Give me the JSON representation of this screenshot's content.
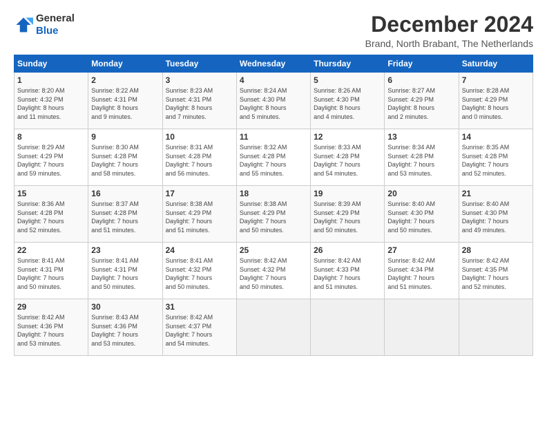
{
  "logo": {
    "line1": "General",
    "line2": "Blue"
  },
  "title": "December 2024",
  "location": "Brand, North Brabant, The Netherlands",
  "days_header": [
    "Sunday",
    "Monday",
    "Tuesday",
    "Wednesday",
    "Thursday",
    "Friday",
    "Saturday"
  ],
  "weeks": [
    [
      {
        "day": 1,
        "lines": [
          "Sunrise: 8:20 AM",
          "Sunset: 4:32 PM",
          "Daylight: 8 hours",
          "and 11 minutes."
        ]
      },
      {
        "day": 2,
        "lines": [
          "Sunrise: 8:22 AM",
          "Sunset: 4:31 PM",
          "Daylight: 8 hours",
          "and 9 minutes."
        ]
      },
      {
        "day": 3,
        "lines": [
          "Sunrise: 8:23 AM",
          "Sunset: 4:31 PM",
          "Daylight: 8 hours",
          "and 7 minutes."
        ]
      },
      {
        "day": 4,
        "lines": [
          "Sunrise: 8:24 AM",
          "Sunset: 4:30 PM",
          "Daylight: 8 hours",
          "and 5 minutes."
        ]
      },
      {
        "day": 5,
        "lines": [
          "Sunrise: 8:26 AM",
          "Sunset: 4:30 PM",
          "Daylight: 8 hours",
          "and 4 minutes."
        ]
      },
      {
        "day": 6,
        "lines": [
          "Sunrise: 8:27 AM",
          "Sunset: 4:29 PM",
          "Daylight: 8 hours",
          "and 2 minutes."
        ]
      },
      {
        "day": 7,
        "lines": [
          "Sunrise: 8:28 AM",
          "Sunset: 4:29 PM",
          "Daylight: 8 hours",
          "and 0 minutes."
        ]
      }
    ],
    [
      {
        "day": 8,
        "lines": [
          "Sunrise: 8:29 AM",
          "Sunset: 4:29 PM",
          "Daylight: 7 hours",
          "and 59 minutes."
        ]
      },
      {
        "day": 9,
        "lines": [
          "Sunrise: 8:30 AM",
          "Sunset: 4:28 PM",
          "Daylight: 7 hours",
          "and 58 minutes."
        ]
      },
      {
        "day": 10,
        "lines": [
          "Sunrise: 8:31 AM",
          "Sunset: 4:28 PM",
          "Daylight: 7 hours",
          "and 56 minutes."
        ]
      },
      {
        "day": 11,
        "lines": [
          "Sunrise: 8:32 AM",
          "Sunset: 4:28 PM",
          "Daylight: 7 hours",
          "and 55 minutes."
        ]
      },
      {
        "day": 12,
        "lines": [
          "Sunrise: 8:33 AM",
          "Sunset: 4:28 PM",
          "Daylight: 7 hours",
          "and 54 minutes."
        ]
      },
      {
        "day": 13,
        "lines": [
          "Sunrise: 8:34 AM",
          "Sunset: 4:28 PM",
          "Daylight: 7 hours",
          "and 53 minutes."
        ]
      },
      {
        "day": 14,
        "lines": [
          "Sunrise: 8:35 AM",
          "Sunset: 4:28 PM",
          "Daylight: 7 hours",
          "and 52 minutes."
        ]
      }
    ],
    [
      {
        "day": 15,
        "lines": [
          "Sunrise: 8:36 AM",
          "Sunset: 4:28 PM",
          "Daylight: 7 hours",
          "and 52 minutes."
        ]
      },
      {
        "day": 16,
        "lines": [
          "Sunrise: 8:37 AM",
          "Sunset: 4:28 PM",
          "Daylight: 7 hours",
          "and 51 minutes."
        ]
      },
      {
        "day": 17,
        "lines": [
          "Sunrise: 8:38 AM",
          "Sunset: 4:29 PM",
          "Daylight: 7 hours",
          "and 51 minutes."
        ]
      },
      {
        "day": 18,
        "lines": [
          "Sunrise: 8:38 AM",
          "Sunset: 4:29 PM",
          "Daylight: 7 hours",
          "and 50 minutes."
        ]
      },
      {
        "day": 19,
        "lines": [
          "Sunrise: 8:39 AM",
          "Sunset: 4:29 PM",
          "Daylight: 7 hours",
          "and 50 minutes."
        ]
      },
      {
        "day": 20,
        "lines": [
          "Sunrise: 8:40 AM",
          "Sunset: 4:30 PM",
          "Daylight: 7 hours",
          "and 50 minutes."
        ]
      },
      {
        "day": 21,
        "lines": [
          "Sunrise: 8:40 AM",
          "Sunset: 4:30 PM",
          "Daylight: 7 hours",
          "and 49 minutes."
        ]
      }
    ],
    [
      {
        "day": 22,
        "lines": [
          "Sunrise: 8:41 AM",
          "Sunset: 4:31 PM",
          "Daylight: 7 hours",
          "and 50 minutes."
        ]
      },
      {
        "day": 23,
        "lines": [
          "Sunrise: 8:41 AM",
          "Sunset: 4:31 PM",
          "Daylight: 7 hours",
          "and 50 minutes."
        ]
      },
      {
        "day": 24,
        "lines": [
          "Sunrise: 8:41 AM",
          "Sunset: 4:32 PM",
          "Daylight: 7 hours",
          "and 50 minutes."
        ]
      },
      {
        "day": 25,
        "lines": [
          "Sunrise: 8:42 AM",
          "Sunset: 4:32 PM",
          "Daylight: 7 hours",
          "and 50 minutes."
        ]
      },
      {
        "day": 26,
        "lines": [
          "Sunrise: 8:42 AM",
          "Sunset: 4:33 PM",
          "Daylight: 7 hours",
          "and 51 minutes."
        ]
      },
      {
        "day": 27,
        "lines": [
          "Sunrise: 8:42 AM",
          "Sunset: 4:34 PM",
          "Daylight: 7 hours",
          "and 51 minutes."
        ]
      },
      {
        "day": 28,
        "lines": [
          "Sunrise: 8:42 AM",
          "Sunset: 4:35 PM",
          "Daylight: 7 hours",
          "and 52 minutes."
        ]
      }
    ],
    [
      {
        "day": 29,
        "lines": [
          "Sunrise: 8:42 AM",
          "Sunset: 4:36 PM",
          "Daylight: 7 hours",
          "and 53 minutes."
        ]
      },
      {
        "day": 30,
        "lines": [
          "Sunrise: 8:43 AM",
          "Sunset: 4:36 PM",
          "Daylight: 7 hours",
          "and 53 minutes."
        ]
      },
      {
        "day": 31,
        "lines": [
          "Sunrise: 8:42 AM",
          "Sunset: 4:37 PM",
          "Daylight: 7 hours",
          "and 54 minutes."
        ]
      },
      null,
      null,
      null,
      null
    ]
  ]
}
